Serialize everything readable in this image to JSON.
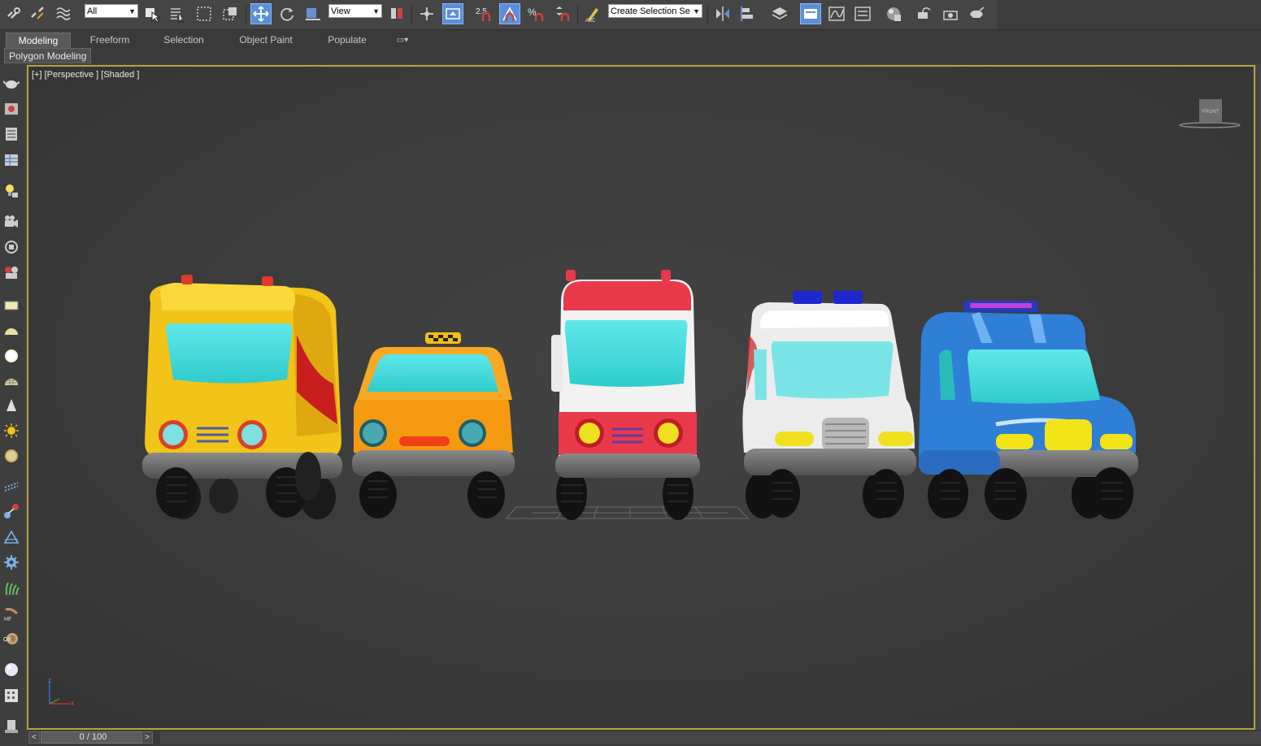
{
  "toolbar": {
    "selection_filter": "All",
    "reference_coord": "View",
    "snap_value": "2.5",
    "named_selection_placeholder": "Create Selection Se"
  },
  "ribbon": {
    "tabs": [
      {
        "label": "Modeling",
        "active": true
      },
      {
        "label": "Freeform",
        "active": false
      },
      {
        "label": "Selection",
        "active": false
      },
      {
        "label": "Object Paint",
        "active": false
      },
      {
        "label": "Populate",
        "active": false
      }
    ],
    "panel_label": "Polygon Modeling"
  },
  "viewport": {
    "label": "[+] [Perspective ] [Shaded ]",
    "viewcube_face": "FRONT",
    "border_color": "#b8a042",
    "axis": {
      "z": "z",
      "x": "x"
    }
  },
  "scene": {
    "vehicles": [
      {
        "name": "yellow-van",
        "body_color": "#f2c318"
      },
      {
        "name": "orange-taxi",
        "body_color": "#f59a10"
      },
      {
        "name": "red-white-fire-truck",
        "body_color": "#e83a4a"
      },
      {
        "name": "white-ambulance",
        "body_color": "#ececec"
      },
      {
        "name": "blue-police-van",
        "body_color": "#2f7fd6"
      }
    ]
  },
  "timeline": {
    "prev_label": "<",
    "next_label": ">",
    "frame_display": "0 / 100"
  },
  "colors": {
    "accent": "#5a8fd8",
    "window_cyan": "#44dede"
  }
}
